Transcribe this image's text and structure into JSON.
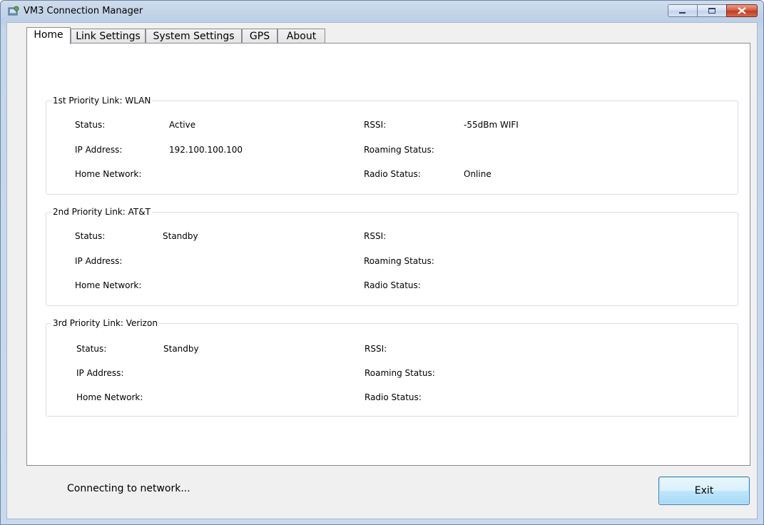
{
  "window": {
    "title": "VM3 Connection Manager",
    "icon": "app-icon",
    "controls": {
      "minimize": "minimize-icon",
      "maximize": "maximize-icon",
      "close": "close-icon"
    }
  },
  "tabs": [
    {
      "label": "Home",
      "active": true
    },
    {
      "label": "Link Settings",
      "active": false
    },
    {
      "label": "System Settings",
      "active": false
    },
    {
      "label": "GPS",
      "active": false
    },
    {
      "label": "About",
      "active": false
    }
  ],
  "groups": [
    {
      "title": "1st Priority Link: WLAN",
      "status_label": "Status:",
      "status_value": "Active",
      "ip_label": "IP Address:",
      "ip_value": "192.100.100.100",
      "home_label": "Home Network:",
      "home_value": "",
      "rssi_label": "RSSI:",
      "rssi_value": "-55dBm WIFI",
      "roaming_label": "Roaming Status:",
      "roaming_value": "",
      "radio_label": "Radio Status:",
      "radio_value": "Online"
    },
    {
      "title": "2nd Priority Link: AT&T",
      "status_label": "Status:",
      "status_value": "Standby",
      "ip_label": "IP Address:",
      "ip_value": "",
      "home_label": "Home Network:",
      "home_value": "",
      "rssi_label": "RSSI:",
      "rssi_value": "",
      "roaming_label": "Roaming Status:",
      "roaming_value": "",
      "radio_label": "Radio Status:",
      "radio_value": ""
    },
    {
      "title": "3rd Priority Link: Verizon",
      "status_label": "Status:",
      "status_value": "Standby",
      "ip_label": "IP Address:",
      "ip_value": "",
      "home_label": "Home Network:",
      "home_value": "",
      "rssi_label": "RSSI:",
      "rssi_value": "",
      "roaming_label": "Roaming Status:",
      "roaming_value": "",
      "radio_label": "Radio Status:",
      "radio_value": ""
    }
  ],
  "status_text": "Connecting to network...",
  "exit_label": "Exit",
  "colors": {
    "exit_button_border": "#3c7fb1",
    "close_button": "#c23b1f",
    "titlebar": "#bccfe6"
  }
}
